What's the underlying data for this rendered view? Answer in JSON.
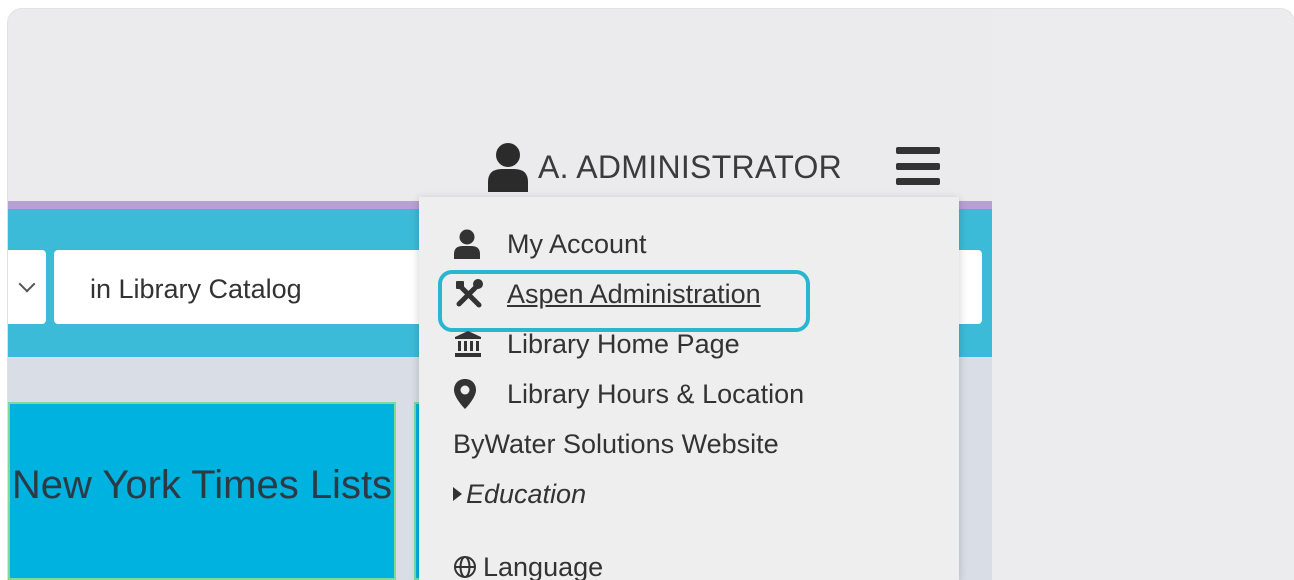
{
  "header": {
    "user_name": "A. ADMINISTRATOR",
    "user_icon": "user-icon",
    "menu_icon": "hamburger-menu-icon"
  },
  "search": {
    "scope_label": "in Library Catalog",
    "dropdown_icon": "chevron-down-icon"
  },
  "tiles": [
    {
      "label": "New York Times Lists"
    }
  ],
  "menu": {
    "items": [
      {
        "label": "My Account",
        "icon": "user-icon"
      },
      {
        "label": "Aspen Administration",
        "icon": "tools-icon",
        "focused": true
      },
      {
        "label": "Library Home Page",
        "icon": "bank-icon"
      },
      {
        "label": "Library Hours & Location",
        "icon": "map-marker-icon"
      },
      {
        "label": "ByWater Solutions Website"
      },
      {
        "label": "Education",
        "icon": "caret-right-icon"
      },
      {
        "label": "Language",
        "icon": "globe-icon"
      }
    ]
  },
  "colors": {
    "search_band": "#3bbbd7",
    "accent_line": "#b7a1d3",
    "tile": "#00b2df",
    "focus_ring": "#29b6cf"
  }
}
